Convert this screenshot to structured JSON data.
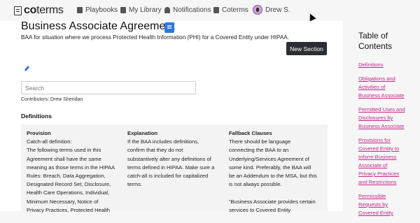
{
  "header": {
    "logo": {
      "text_bold": "co",
      "text": "terms"
    },
    "nav": [
      {
        "label": "Playbooks",
        "icon": "book-icon"
      },
      {
        "label": "My Library",
        "icon": "list-icon"
      },
      {
        "label": "Notifications",
        "icon": "bell-icon"
      },
      {
        "label": "Coterms",
        "icon": "building-icon"
      }
    ],
    "user": {
      "name": "Drew S."
    }
  },
  "document": {
    "title": "Business Associate Agreement",
    "subtitle": "BAA for situation where we process Protected Health Information (PHI) for a Covered Entity under HIPAA.",
    "new_section_label": "New Section",
    "search_placeholder": "Search",
    "contributors": "Contributors: Drew Sheridan",
    "section_heading": "Definitions"
  },
  "table": {
    "columns": [
      {
        "header": "Provision",
        "lines": [
          "Catch-all definition:",
          "The following terms used in this",
          "Agreement shall have the same",
          "meaning as those terms in the HIPAA",
          "Rules: Breach, Data Aggregation,",
          "Designated Record Set, Disclosure,",
          "Health Care Operations, Individual,",
          "Minimum Necessary, Notice of",
          "Privacy Practices, Protected Health"
        ]
      },
      {
        "header": "Explanation",
        "lines": [
          "If the BAA includes definitions,",
          "confirm that they do not",
          "substantively alter any definitions of",
          "terms defined in HIPAA.  Make sure a",
          "catch-all is included for capitalized",
          "terms."
        ]
      },
      {
        "header": "Fallback Clauses",
        "lines": [
          "There should be language",
          "connecting the BAA to an",
          "Underlying/Services Agreement of",
          "some kind. Preferably, the BAA will",
          "be an Addendum to the MSA, but this",
          "is not always possible.",
          "",
          "“Business Associate provides certain",
          "services to Covered Entity"
        ]
      }
    ]
  },
  "toc": {
    "title_line1": "Table of",
    "title_line2": "Contents",
    "links": [
      [
        "Definitions"
      ],
      [
        "Obligations and",
        "Activities of",
        "Business Associate"
      ],
      [
        "Permitted Uses and",
        "Disclosures by",
        "Business Associate"
      ],
      [
        "Provisions for",
        "Covered Entity to",
        "Inform Business",
        "Associate of",
        "Privacy Practices",
        "and Restrictions"
      ],
      [
        "Permissible",
        "Requests by",
        "Covered Entity"
      ]
    ]
  },
  "colors": {
    "link": "#c0288a",
    "button_bg": "#2b2f33",
    "doc_icon": "#2b78e4"
  }
}
